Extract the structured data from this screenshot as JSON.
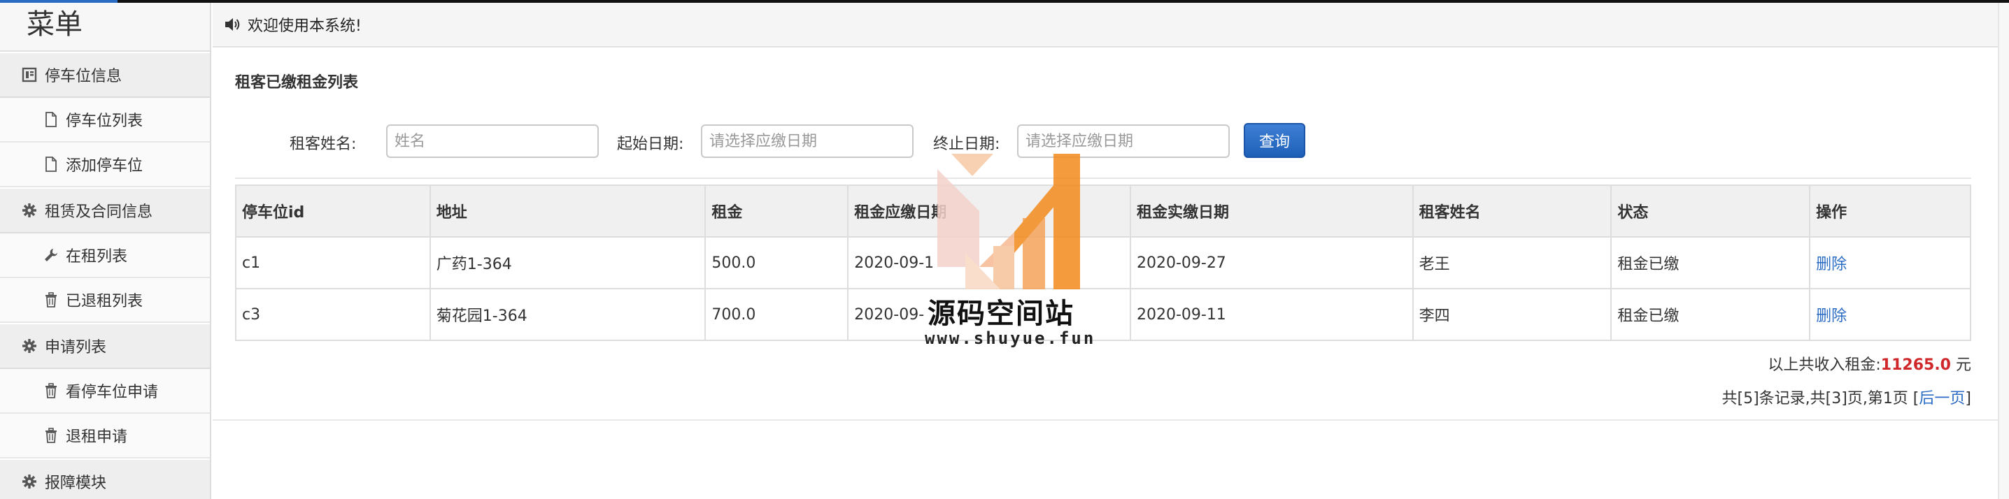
{
  "sidebar": {
    "title": "菜单",
    "sections": [
      {
        "label": "停车位信息",
        "icon": "list-box-icon",
        "items": [
          {
            "label": "停车位列表",
            "icon": "file-icon"
          },
          {
            "label": "添加停车位",
            "icon": "file-icon"
          }
        ]
      },
      {
        "label": "租赁及合同信息",
        "icon": "gear-icon",
        "items": [
          {
            "label": "在租列表",
            "icon": "wrench-icon"
          },
          {
            "label": "已退租列表",
            "icon": "trash-icon"
          }
        ]
      },
      {
        "label": "申请列表",
        "icon": "gear-icon",
        "items": [
          {
            "label": "看停车位申请",
            "icon": "trash-icon"
          },
          {
            "label": "退租申请",
            "icon": "trash-icon"
          }
        ]
      },
      {
        "label": "报障模块",
        "icon": "gear-icon",
        "items": []
      }
    ]
  },
  "topbar": {
    "message": "欢迎使用本系统!",
    "icon": "speaker-icon"
  },
  "panel": {
    "title": "租客已缴租金列表"
  },
  "filters": {
    "name_label": "租客姓名:",
    "name_placeholder": "姓名",
    "start_label": "起始日期:",
    "start_placeholder": "请选择应缴日期",
    "end_label": "终止日期:",
    "end_placeholder": "请选择应缴日期",
    "query_label": "查询"
  },
  "table": {
    "headers": [
      "停车位id",
      "地址",
      "租金",
      "租金应缴日期",
      "租金实缴日期",
      "租客姓名",
      "状态",
      "操作"
    ],
    "rows": [
      {
        "id": "c1",
        "address": "广药1-364",
        "rent": "500.0",
        "due": "2020-09-1",
        "paid": "2020-09-27",
        "tenant": "老王",
        "status": "租金已缴",
        "action": "删除"
      },
      {
        "id": "c3",
        "address": "菊花园1-364",
        "rent": "700.0",
        "due": "2020-09-",
        "paid": "2020-09-11",
        "tenant": "李四",
        "status": "租金已缴",
        "action": "删除"
      }
    ]
  },
  "summary": {
    "prefix": "以上共收入租金:",
    "amount": "11265.0",
    "unit": "元"
  },
  "pager": {
    "text": "共[5]条记录,共[3]页,第1页 [",
    "next": "后一页",
    "close": "]"
  },
  "watermark": {
    "title": "源码空间站",
    "url": "www.shuyue.fun"
  },
  "colors": {
    "accent": "#2a6bc4",
    "amount": "#d0282a",
    "button": "#1e5fb8"
  }
}
